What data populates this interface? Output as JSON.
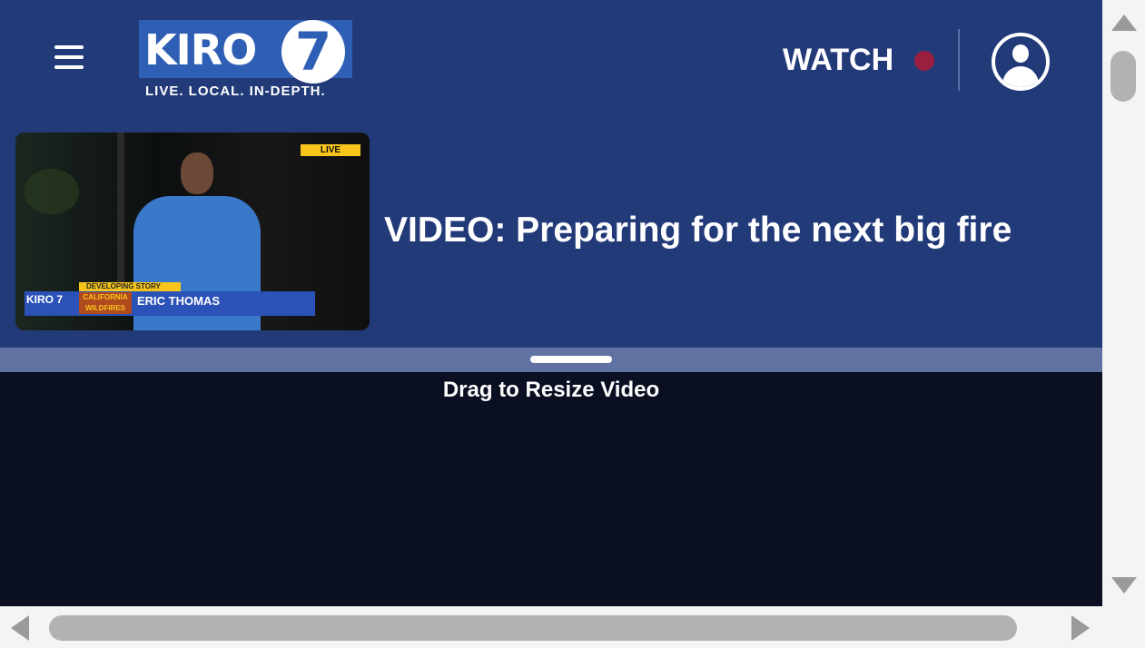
{
  "header": {
    "logo_text": "KIRO",
    "logo_number": "7",
    "tagline": "LIVE. LOCAL. IN-DEPTH.",
    "watch_label": "WATCH"
  },
  "video": {
    "live_tag": "LIVE",
    "developing_tag": "DEVELOPING STORY",
    "channel_bug": "KIRO 7",
    "topic_tag": "CALIFORNIA WILDFIRES",
    "reporter_name": "ERIC THOMAS",
    "headline": "VIDEO: Preparing for the next big fire"
  },
  "resize": {
    "label": "Drag to Resize Video"
  },
  "colors": {
    "header_bg": "#233a79",
    "logo_blue": "#2f5fb5",
    "live_dot": "#9a1f3e",
    "resize_bar": "#5f72a2",
    "page_bg": "#0a0f22"
  },
  "icons": {
    "menu": "hamburger-menu-icon",
    "profile": "user-profile-icon",
    "live_dot": "live-indicator-dot-icon"
  }
}
